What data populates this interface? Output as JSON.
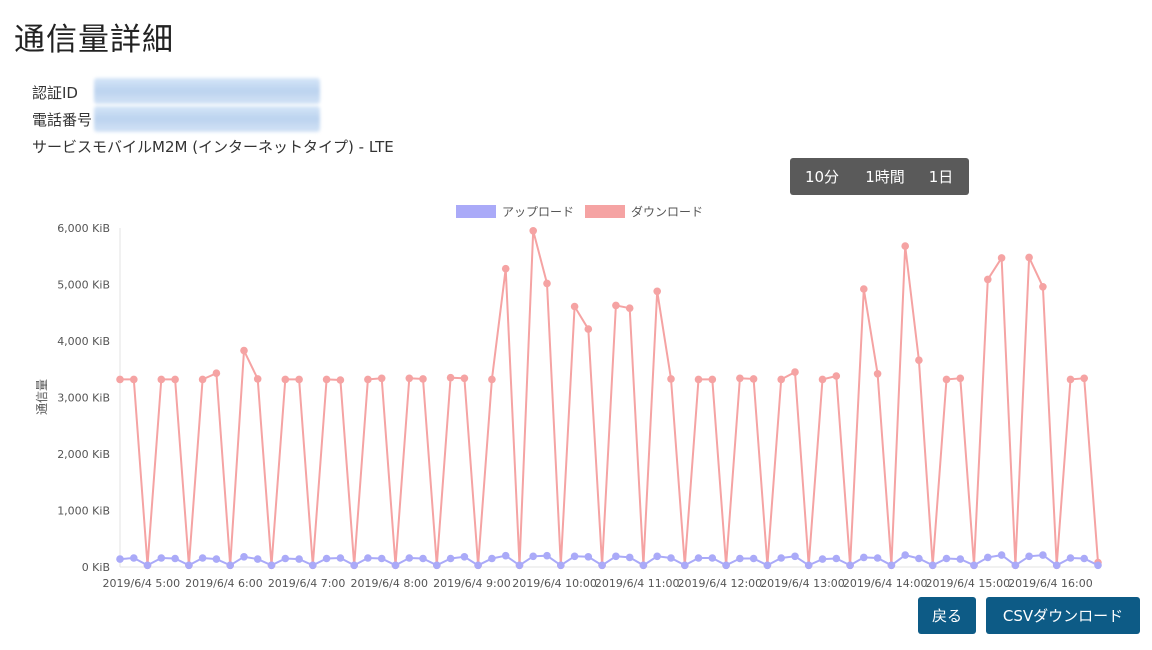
{
  "page": {
    "title": "通信量詳細"
  },
  "info": {
    "auth_label": "認証ID",
    "phone_label": "電話番号",
    "service_text": "サービスモバイルM2M (インターネットタイプ) - LTE"
  },
  "range_buttons": [
    {
      "label": "10分"
    },
    {
      "label": "1時間"
    },
    {
      "label": "1日"
    }
  ],
  "actions": {
    "back_label": "戻る",
    "csv_label": "CSVダウンロード"
  },
  "chart_data": {
    "type": "line",
    "ylabel": "通信量",
    "ylim": [
      0,
      6000
    ],
    "y_ticks": [
      "0 KiB",
      "1,000 KiB",
      "2,000 KiB",
      "3,000 KiB",
      "4,000 KiB",
      "5,000 KiB",
      "6,000 KiB"
    ],
    "x_tick_labels": [
      "2019/6/4 5:00",
      "2019/6/4 6:00",
      "2019/6/4 7:00",
      "2019/6/4 8:00",
      "2019/6/4 9:00",
      "2019/6/4 10:00",
      "2019/6/4 11:00",
      "2019/6/4 12:00",
      "2019/6/4 13:00",
      "2019/6/4 14:00",
      "2019/6/4 15:00",
      "2019/6/4 16:00"
    ],
    "legend_position": "top",
    "series": [
      {
        "name": "アップロード",
        "color": "#aaaaf8",
        "values": [
          140,
          160,
          30,
          160,
          150,
          30,
          160,
          140,
          30,
          180,
          140,
          30,
          150,
          140,
          30,
          150,
          160,
          30,
          160,
          150,
          30,
          160,
          150,
          30,
          150,
          180,
          30,
          150,
          200,
          30,
          190,
          200,
          30,
          190,
          180,
          30,
          190,
          170,
          30,
          190,
          160,
          30,
          160,
          160,
          30,
          150,
          150,
          30,
          160,
          190,
          30,
          140,
          150,
          30,
          170,
          160,
          30,
          210,
          150,
          30,
          150,
          140,
          30,
          170,
          210,
          30,
          190,
          210,
          30,
          160,
          150,
          30
        ]
      },
      {
        "name": "ダウンロード",
        "color": "#f5a3a3",
        "values": [
          3320,
          3320,
          30,
          3320,
          3320,
          30,
          3320,
          3430,
          30,
          3830,
          3330,
          30,
          3320,
          3320,
          30,
          3320,
          3310,
          30,
          3320,
          3340,
          30,
          3340,
          3330,
          30,
          3350,
          3340,
          30,
          3320,
          5280,
          30,
          5950,
          5020,
          30,
          4610,
          4210,
          30,
          4630,
          4580,
          30,
          4880,
          3330,
          30,
          3320,
          3320,
          30,
          3340,
          3330,
          30,
          3320,
          3450,
          30,
          3320,
          3380,
          30,
          4920,
          3420,
          30,
          5680,
          3660,
          30,
          3320,
          3340,
          30,
          5090,
          5470,
          30,
          5480,
          4960,
          30,
          3320,
          3340,
          80
        ]
      }
    ]
  }
}
